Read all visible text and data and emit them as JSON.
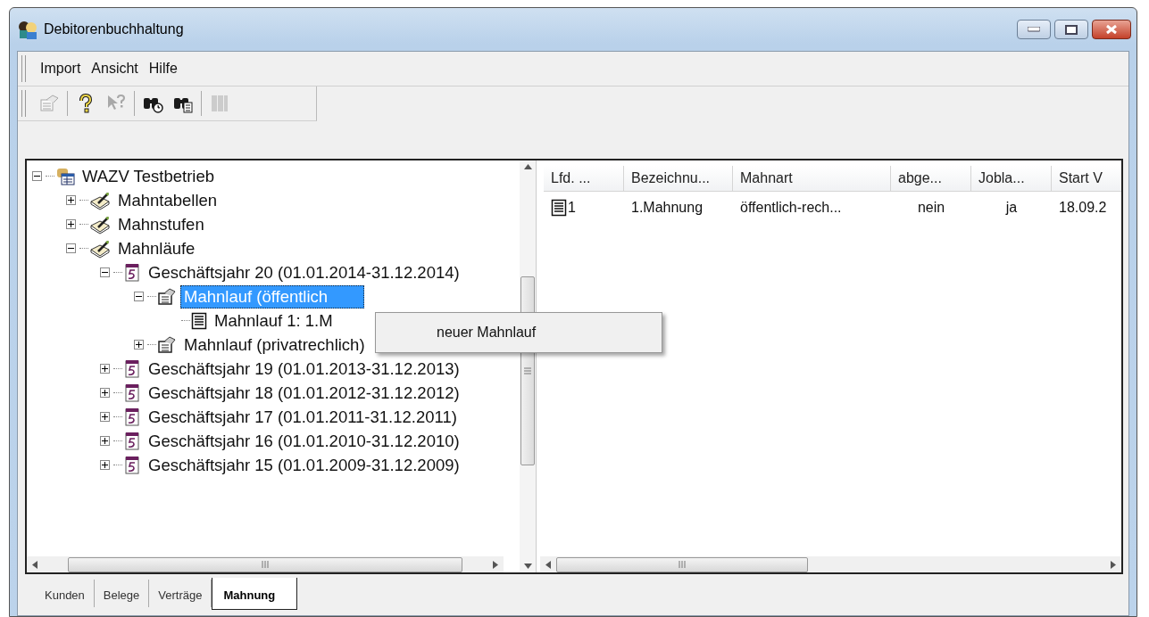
{
  "window": {
    "title": "Debitorenbuchhaltung"
  },
  "menu": [
    {
      "label": "Import"
    },
    {
      "label": "Ansicht"
    },
    {
      "label": "Hilfe"
    }
  ],
  "toolbar": [
    {
      "kind": "properties",
      "disabled": true
    },
    {
      "kind": "separator"
    },
    {
      "kind": "help",
      "disabled": false
    },
    {
      "kind": "context-help",
      "disabled": true
    },
    {
      "kind": "separator"
    },
    {
      "kind": "find",
      "disabled": false
    },
    {
      "kind": "find-list",
      "disabled": false
    },
    {
      "kind": "separator"
    },
    {
      "kind": "barcode",
      "disabled": true
    }
  ],
  "tree": [
    {
      "label": "WAZV Testbetrieb",
      "kind": "root",
      "expanded": true,
      "selected": false,
      "children": [
        {
          "label": "Mahntabellen",
          "kind": "book",
          "expanded": false,
          "selected": false
        },
        {
          "label": "Mahnstufen",
          "kind": "book",
          "expanded": false,
          "selected": false
        },
        {
          "label": "Mahnläufe",
          "kind": "book",
          "expanded": true,
          "selected": false,
          "children": [
            {
              "label": "Geschäftsjahr 20 (01.01.2014-31.12.2014)",
              "kind": "year",
              "expanded": true,
              "selected": false,
              "children": [
                {
                  "label": "Mahnlauf (öffentlich",
                  "kind": "run",
                  "expanded": true,
                  "selected": true,
                  "children": [
                    {
                      "label": "Mahnlauf 1: 1.M",
                      "kind": "document",
                      "selected": false
                    }
                  ]
                },
                {
                  "label": "Mahnlauf (privatrechlich)",
                  "kind": "run",
                  "expanded": false,
                  "selected": false
                }
              ]
            },
            {
              "label": "Geschäftsjahr 19 (01.01.2013-31.12.2013)",
              "kind": "year",
              "expanded": false,
              "selected": false
            },
            {
              "label": "Geschäftsjahr 18 (01.01.2012-31.12.2012)",
              "kind": "year",
              "expanded": false,
              "selected": false
            },
            {
              "label": "Geschäftsjahr 17 (01.01.2011-31.12.2011)",
              "kind": "year",
              "expanded": false,
              "selected": false
            },
            {
              "label": "Geschäftsjahr 16 (01.01.2010-31.12.2010)",
              "kind": "year",
              "expanded": false,
              "selected": false
            },
            {
              "label": "Geschäftsjahr 15 (01.01.2009-31.12.2009)",
              "kind": "year",
              "expanded": false,
              "selected": false
            }
          ]
        }
      ]
    }
  ],
  "context_menu": {
    "items": [
      "neuer Mahnlauf"
    ]
  },
  "table": {
    "columns": [
      "Lfd. ...",
      "Bezeichnu...",
      "Mahnart",
      "abge...",
      "Jobla...",
      "Start V"
    ],
    "rows": [
      [
        "1",
        "1.Mahnung",
        "öffentlich-rech...",
        "nein",
        "ja",
        "18.09.2"
      ]
    ]
  },
  "tabs": [
    {
      "label": "Kunden",
      "selected": false
    },
    {
      "label": "Belege",
      "selected": false
    },
    {
      "label": "Verträge",
      "selected": false
    },
    {
      "label": "Mahnung",
      "selected": true
    }
  ]
}
